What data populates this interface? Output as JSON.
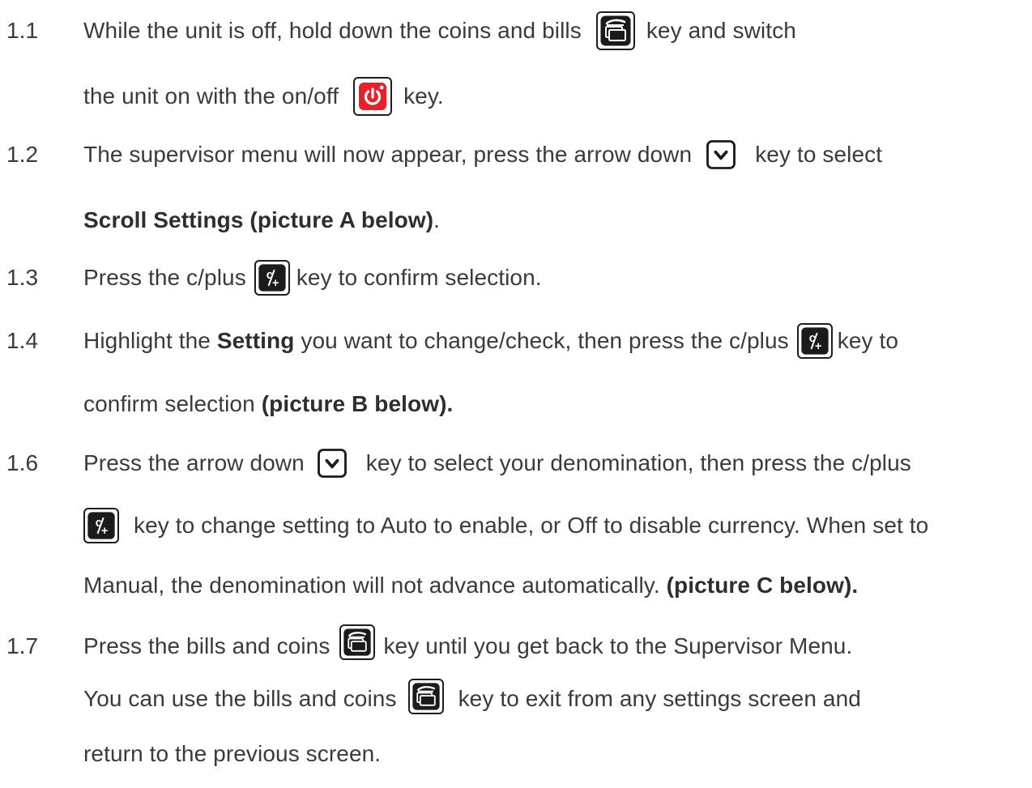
{
  "steps": [
    {
      "num": "1.1",
      "l1a": "While the unit is off, hold down the coins and bills",
      "l1b": "key and switch",
      "l2a": "the unit on with the on/off",
      "l2b": "key."
    },
    {
      "num": "1.2",
      "l1a": "The supervisor menu will now appear, press the arrow down",
      "l1b": "key to select",
      "l2bold": "Scroll Settings (picture A below)",
      "l2c": "."
    },
    {
      "num": "1.3",
      "l1a": "Press the c/plus",
      "l1b": "key to confirm selection."
    },
    {
      "num": "1.4",
      "l1a": "Highlight the",
      "l1bold": "Setting",
      "l1b": "you want to change/check, then press the c/plus",
      "l1c": "key to",
      "l2a": "confirm selection",
      "l2bold": "(picture B below)."
    },
    {
      "num": "1.6",
      "l1a": "Press the arrow down",
      "l1b": "key to select your denomination, then press the c/plus",
      "l2a": "key to change setting to Auto to enable, or Off to disable currency. When set to",
      "l3a": "Manual, the denomination will not advance automatically.",
      "l3bold": "(picture C below)."
    },
    {
      "num": "1.7",
      "l1a": "Press the bills and coins",
      "l1b": "key until you get back to the Supervisor Menu.",
      "l2a": "You can use the bills and coins",
      "l2b": "key to exit from any settings screen and",
      "l3a": "return to the previous screen."
    }
  ],
  "colors": {
    "text": "#3a3a3a",
    "power_key": "#e8202a"
  },
  "icons": [
    "coins-bills-key-icon",
    "power-key-icon",
    "arrow-down-key-icon",
    "c-plus-key-icon"
  ]
}
